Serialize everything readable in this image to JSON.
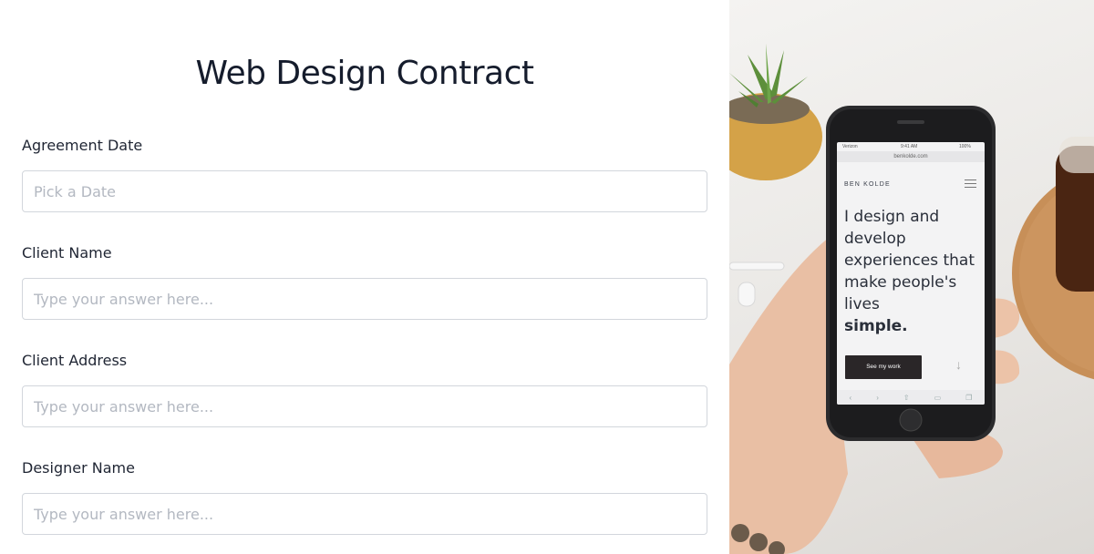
{
  "form": {
    "title": "Web Design Contract",
    "fields": [
      {
        "label": "Agreement Date",
        "placeholder": "Pick a Date"
      },
      {
        "label": "Client Name",
        "placeholder": "Type your answer here..."
      },
      {
        "label": "Client Address",
        "placeholder": "Type your answer here..."
      },
      {
        "label": "Designer Name",
        "placeholder": "Type your answer here..."
      }
    ]
  },
  "photo": {
    "phone": {
      "status_carrier": "Verizon",
      "status_time": "9:41 AM",
      "status_battery": "100%",
      "url": "benkolde.com",
      "brand": "BEN KOLDE",
      "hero_text": "I design and develop experiences that make people's lives",
      "hero_bold": "simple.",
      "cta_label": "See my work"
    },
    "colors": {
      "plant": "#5f8f3e",
      "pot": "#d6a64a",
      "cork": "#c9925c",
      "drink": "#5a2e16"
    }
  }
}
